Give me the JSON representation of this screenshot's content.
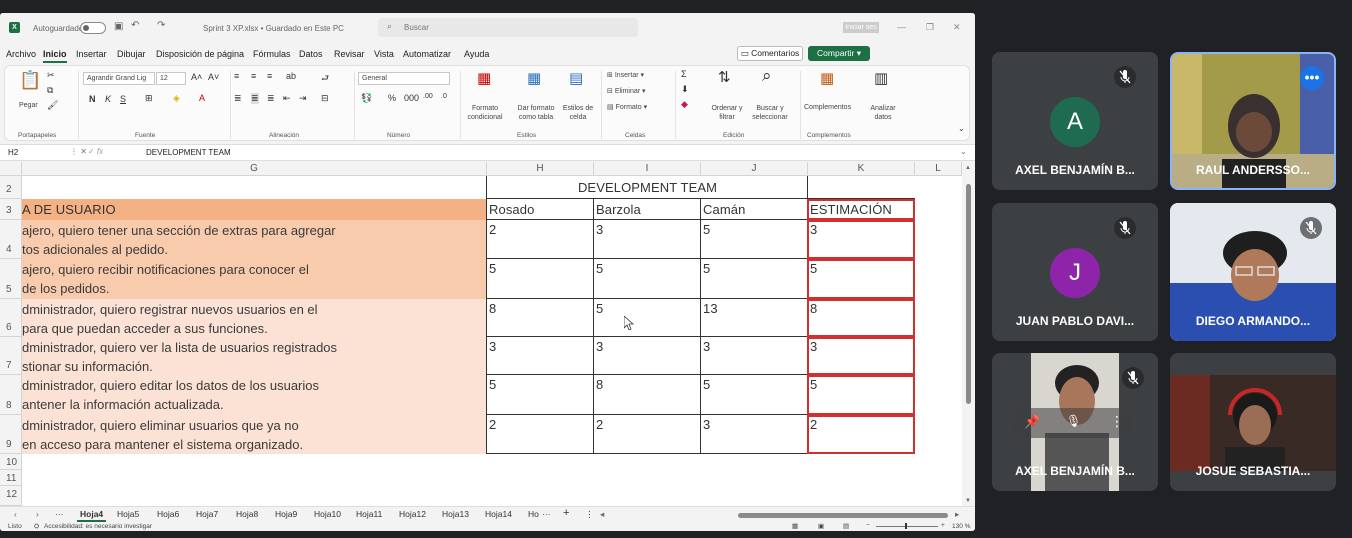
{
  "excel": {
    "autosave_label": "Autoguardado",
    "doc_title": "Sprint 3 XP.xlsx • Guardado en Este PC",
    "search_placeholder": "Buscar",
    "signin_label": "Iniciar ses",
    "menu": [
      "Archivo",
      "Inicio",
      "Insertar",
      "Dibujar",
      "Disposición de página",
      "Fórmulas",
      "Datos",
      "Revisar",
      "Vista",
      "Automatizar",
      "Ayuda"
    ],
    "active_menu": "Inicio",
    "comments_label": "Comentarios",
    "share_label": "Compartir",
    "ribbon": {
      "paste": "Pegar",
      "font_name": "Agrandir Grand Lig",
      "font_size": "12",
      "number_format": "General",
      "conditional_format": "Formato condicional",
      "format_as_table": "Dar formato como tabla",
      "cell_styles": "Estilos de celda",
      "insert": "Insertar",
      "delete": "Eliminar",
      "format": "Formato",
      "sort_filter": "Ordenar y filtrar",
      "find_select": "Buscar y seleccionar",
      "addins": "Complementos",
      "analyze": "Analizar datos",
      "groups": [
        "Portapapeles",
        "Fuente",
        "Alineación",
        "Número",
        "Estilos",
        "Celdas",
        "Edición",
        "Complementos"
      ]
    },
    "name_box": "H2",
    "formula_value": "DEVELOPMENT TEAM",
    "columns": [
      "G",
      "H",
      "I",
      "J",
      "K",
      "L"
    ],
    "rows": [
      "2",
      "3",
      "4",
      "5",
      "6",
      "7",
      "8",
      "9",
      "10",
      "11",
      "12"
    ],
    "team_header": "DEVELOPMENT TEAM",
    "story_header": "A DE USUARIO",
    "member_headers": [
      "Rosado",
      "Barzola",
      "Camán",
      "ESTIMACIÓN"
    ],
    "stories": [
      {
        "l1": "ajero, quiero tener una sección de extras para agregar",
        "l2": "tos adicionales al pedido.",
        "v": [
          "2",
          "3",
          "5",
          "3"
        ]
      },
      {
        "l1": "ajero, quiero recibir notificaciones para conocer el",
        "l2": "de los pedidos.",
        "v": [
          "5",
          "5",
          "5",
          "5"
        ]
      },
      {
        "l1": "dministrador, quiero registrar nuevos usuarios en el",
        "l2": " para que puedan acceder a sus funciones.",
        "v": [
          "8",
          "5",
          "13",
          "8"
        ]
      },
      {
        "l1": "dministrador, quiero ver la lista de usuarios registrados",
        "l2": "stionar su información.",
        "v": [
          "3",
          "3",
          "3",
          "3"
        ]
      },
      {
        "l1": "dministrador, quiero editar los datos de los usuarios",
        "l2": "antener la información actualizada.",
        "v": [
          "5",
          "8",
          "5",
          "5"
        ]
      },
      {
        "l1": "dministrador, quiero eliminar usuarios que ya no",
        "l2": "en acceso para mantener el sistema organizado.",
        "v": [
          "2",
          "2",
          "3",
          "2"
        ]
      }
    ],
    "sheet_tabs": [
      "Hoja4",
      "Hoja5",
      "Hoja6",
      "Hoja7",
      "Hoja8",
      "Hoja9",
      "Hoja10",
      "Hoja11",
      "Hoja12",
      "Hoja13",
      "Hoja14",
      "Ho"
    ],
    "active_tab": "Hoja4",
    "status_ready": "Listo",
    "status_accessibility": "Accesibilidad: es necesario investigar",
    "zoom": "130 %",
    "colors": {
      "story_fill": "#f4b183",
      "story_fill_light": "#fbe2d5",
      "accent": "#1d7044",
      "estimation_border": "#d32f2f"
    }
  },
  "meet": {
    "participants": [
      {
        "name": "AXEL BENJAMÍN B...",
        "initial": "A",
        "color": "#1e6b52",
        "muted": true,
        "video": false
      },
      {
        "name": "RAUL ANDERSSO...",
        "initial": "",
        "color": "",
        "muted": false,
        "video": true
      },
      {
        "name": "JUAN PABLO DAVI...",
        "initial": "J",
        "color": "#8e24aa",
        "muted": true,
        "video": false
      },
      {
        "name": "DIEGO ARMANDO...",
        "initial": "",
        "color": "",
        "muted": true,
        "video": true
      },
      {
        "name": "AXEL BENJAMÍN B...",
        "initial": "",
        "color": "",
        "muted": true,
        "video": true
      },
      {
        "name": "JOSUE SEBASTIA...",
        "initial": "",
        "color": "",
        "muted": false,
        "video": true
      }
    ]
  }
}
